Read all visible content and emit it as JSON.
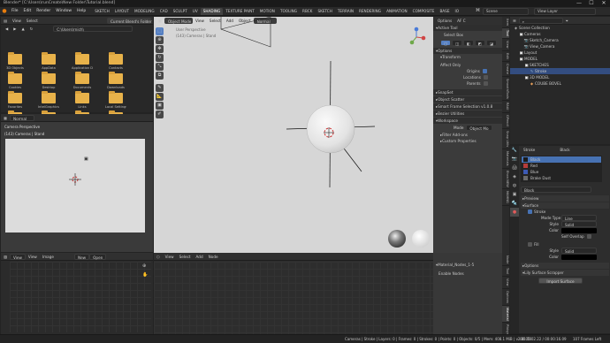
{
  "window": {
    "title": "Blender* [C:\\Users\\runCreate\\New Folder\\Tutorial.blend]",
    "min": "—",
    "max": "☐",
    "close": "✕"
  },
  "menu": [
    "File",
    "Edit",
    "Render",
    "Window",
    "Help"
  ],
  "workspaces": [
    "SKETCH",
    "LAYOUT",
    "MODELING",
    "CAD",
    "SCULPT",
    "UV",
    "SHADING",
    "TEXTURE PAINT",
    "MOTION",
    "TOOLING",
    "RBCK",
    "SKETCH",
    "TERRAIN",
    "RENDERING",
    "ANIMATION",
    "COMPOSITE",
    "BASE",
    "IO"
  ],
  "active_workspace": "SHADING",
  "scene": {
    "label": "Scene",
    "view_layer": "View Layer"
  },
  "file_browser": {
    "menus": [
      "View",
      "Select"
    ],
    "bookmark": "Current Blend's Folder",
    "path": "C:\\Users\\rnich\\",
    "folders": [
      "3D Objects",
      "AppData",
      "Application Da...",
      "Contacts",
      "Cookies",
      "Desktop",
      "Documents",
      "Downloads",
      "Favorites",
      "IntelGraphicsP...",
      "Links",
      "Local Settings",
      "Music",
      "My Documents",
      "NetHood",
      "OneDrive"
    ]
  },
  "camera_view": {
    "mode": "Normal",
    "title": "Camera Perspective",
    "subtitle": "(143) Cameras | Stand"
  },
  "viewport": {
    "mode": "Object Mode",
    "menus": [
      "View",
      "Select",
      "Add",
      "Object"
    ],
    "shading": "Normal",
    "title": "User Perspective",
    "subtitle": "(143) Cameras | Stand"
  },
  "npanel": {
    "options_label": "Options",
    "af_label": "AF C",
    "active_tool": "Active Tool",
    "select_box": "Select Box",
    "options": "Options",
    "transform": "Transform",
    "affect_only": "Affect Only",
    "origins": "Origins",
    "locations": "Locations",
    "parents": "Parents",
    "snapset": "SnapSet",
    "object_scatter": "Object Scatter",
    "smart_frame": "Smart Frame Selection v1.0.8",
    "bezier": "Bezier Utilities",
    "workspace": "Workspace",
    "mode_label": "Mode",
    "mode_value": "Object Mo",
    "filter_addons": "Filter Add-ons",
    "custom_props": "Custom Properties"
  },
  "vtabs": [
    "Item",
    "Tool",
    "View",
    "Edit",
    "Create",
    "SmoothTools",
    "RAAI",
    "GPencil",
    "Snap Utils",
    "Materials",
    "Ehon NEW",
    "MAHNG"
  ],
  "active_vtab": "Tool",
  "outliner": {
    "items": [
      {
        "label": "Scene Collection",
        "indent": 0
      },
      {
        "label": "Cameras",
        "indent": 1
      },
      {
        "label": "Sketch_Camera",
        "indent": 2
      },
      {
        "label": "View_Camera",
        "indent": 2
      },
      {
        "label": "Layout",
        "indent": 1
      },
      {
        "label": "MODEL",
        "indent": 1
      },
      {
        "label": "SKETCHES",
        "indent": 2
      },
      {
        "label": "Stroke",
        "indent": 3
      },
      {
        "label": "3D MODEL",
        "indent": 2
      },
      {
        "label": "COUBE BOVEL",
        "indent": 3
      }
    ]
  },
  "properties": {
    "object": "Stroke",
    "material": "Black",
    "slots": [
      "Black",
      "Red",
      "Blue",
      "Brake Dust"
    ],
    "slot_colors": [
      "#1a1a1a",
      "#b43c3c",
      "#3c5ab4",
      "#6a6a6a"
    ],
    "mat_name": "Black",
    "preview": "Preview",
    "surface": "Surface",
    "stroke": "Stroke",
    "line_type_label": "Mode Type",
    "line_type": "Line",
    "style_label": "Style",
    "style": "Solid",
    "color_label": "Color",
    "self_overlap": "Self Overlap",
    "fill": "Fill",
    "fill_style": "Solid",
    "fill_color_label": "Color",
    "options": "Options",
    "scrapper": "Lily Surface Scrapper",
    "import": "Import Surface"
  },
  "image_editor": {
    "menus": [
      "View",
      "View",
      "Image"
    ],
    "new": "New",
    "open": "Open"
  },
  "node_editor": {
    "menus": [
      "View",
      "Select",
      "Add",
      "Node"
    ],
    "panel_title": "Material_Nodes_1-5",
    "panel_sub": "Enable Nodes",
    "tabs": [
      "Node",
      "Tool",
      "View",
      "Options",
      "Material",
      "Pibbyx"
    ]
  },
  "status": {
    "text": "Cameras | Stroke | Layers: 0 | Frames: 0 | Strokes: 0 | Points: 0 | Objects: 0/5 | Mem: 408.1 MiB | v2.81.16",
    "time": "00:05:02.22 / 00:00:16.09",
    "frames": "107 Frames Left"
  }
}
